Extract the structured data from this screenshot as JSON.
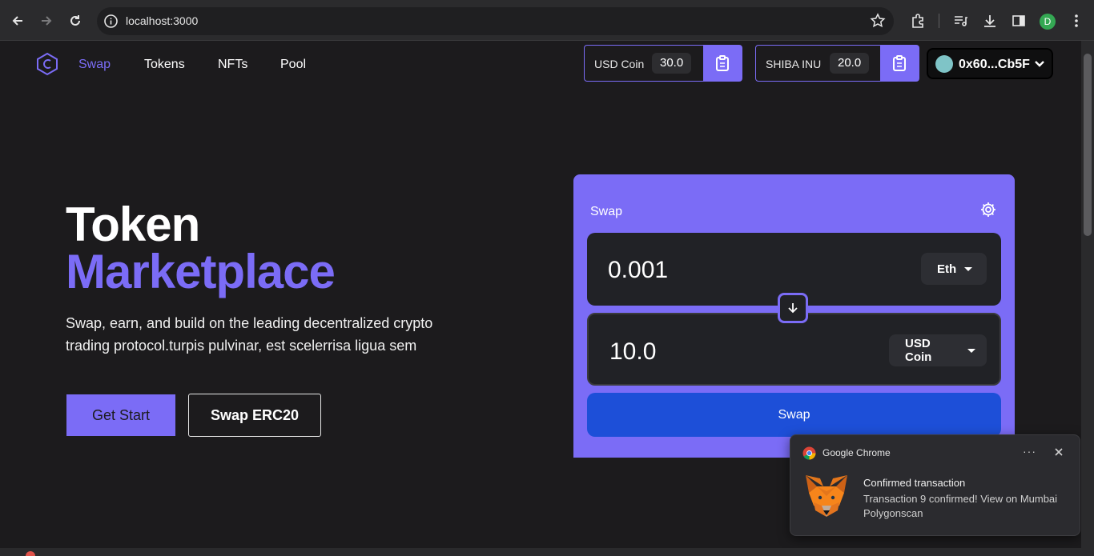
{
  "browser": {
    "url": "localhost:3000",
    "profile_initial": "D",
    "icons": [
      "back-icon",
      "forward-icon",
      "reload-icon",
      "info-icon",
      "star-icon",
      "extensions-icon",
      "media-icon",
      "download-icon",
      "sidepanel-icon",
      "more-icon"
    ]
  },
  "nav": {
    "items": [
      {
        "label": "Swap",
        "active": true
      },
      {
        "label": "Tokens",
        "active": false
      },
      {
        "label": "NFTs",
        "active": false
      },
      {
        "label": "Pool",
        "active": false
      }
    ]
  },
  "tokens": [
    {
      "name": "USD Coin",
      "balance": "30.0"
    },
    {
      "name": "SHIBA INU",
      "balance": "20.0"
    }
  ],
  "wallet": {
    "address": "0x60...Cb5F"
  },
  "hero": {
    "title_line1": "Token",
    "title_line2": "Marketplace",
    "description": "Swap, earn, and build on the leading decentralized crypto trading protocol.turpis pulvinar, est scelerrisa ligua sem",
    "primary_button": "Get Start",
    "secondary_button": "Swap ERC20"
  },
  "swap": {
    "title": "Swap",
    "from_amount": "0.001",
    "from_token": "Eth",
    "to_amount": "10.0",
    "to_token": "USD Coin",
    "button": "Swap"
  },
  "notification": {
    "app": "Google Chrome",
    "more": "···",
    "title": "Confirmed transaction",
    "body": "Transaction 9 confirmed! View on Mumbai Polygonscan"
  },
  "colors": {
    "accent": "#7b6cf6",
    "background": "#1c1b1d",
    "swap_button": "#1d4fd8",
    "input_bg": "#212226"
  }
}
